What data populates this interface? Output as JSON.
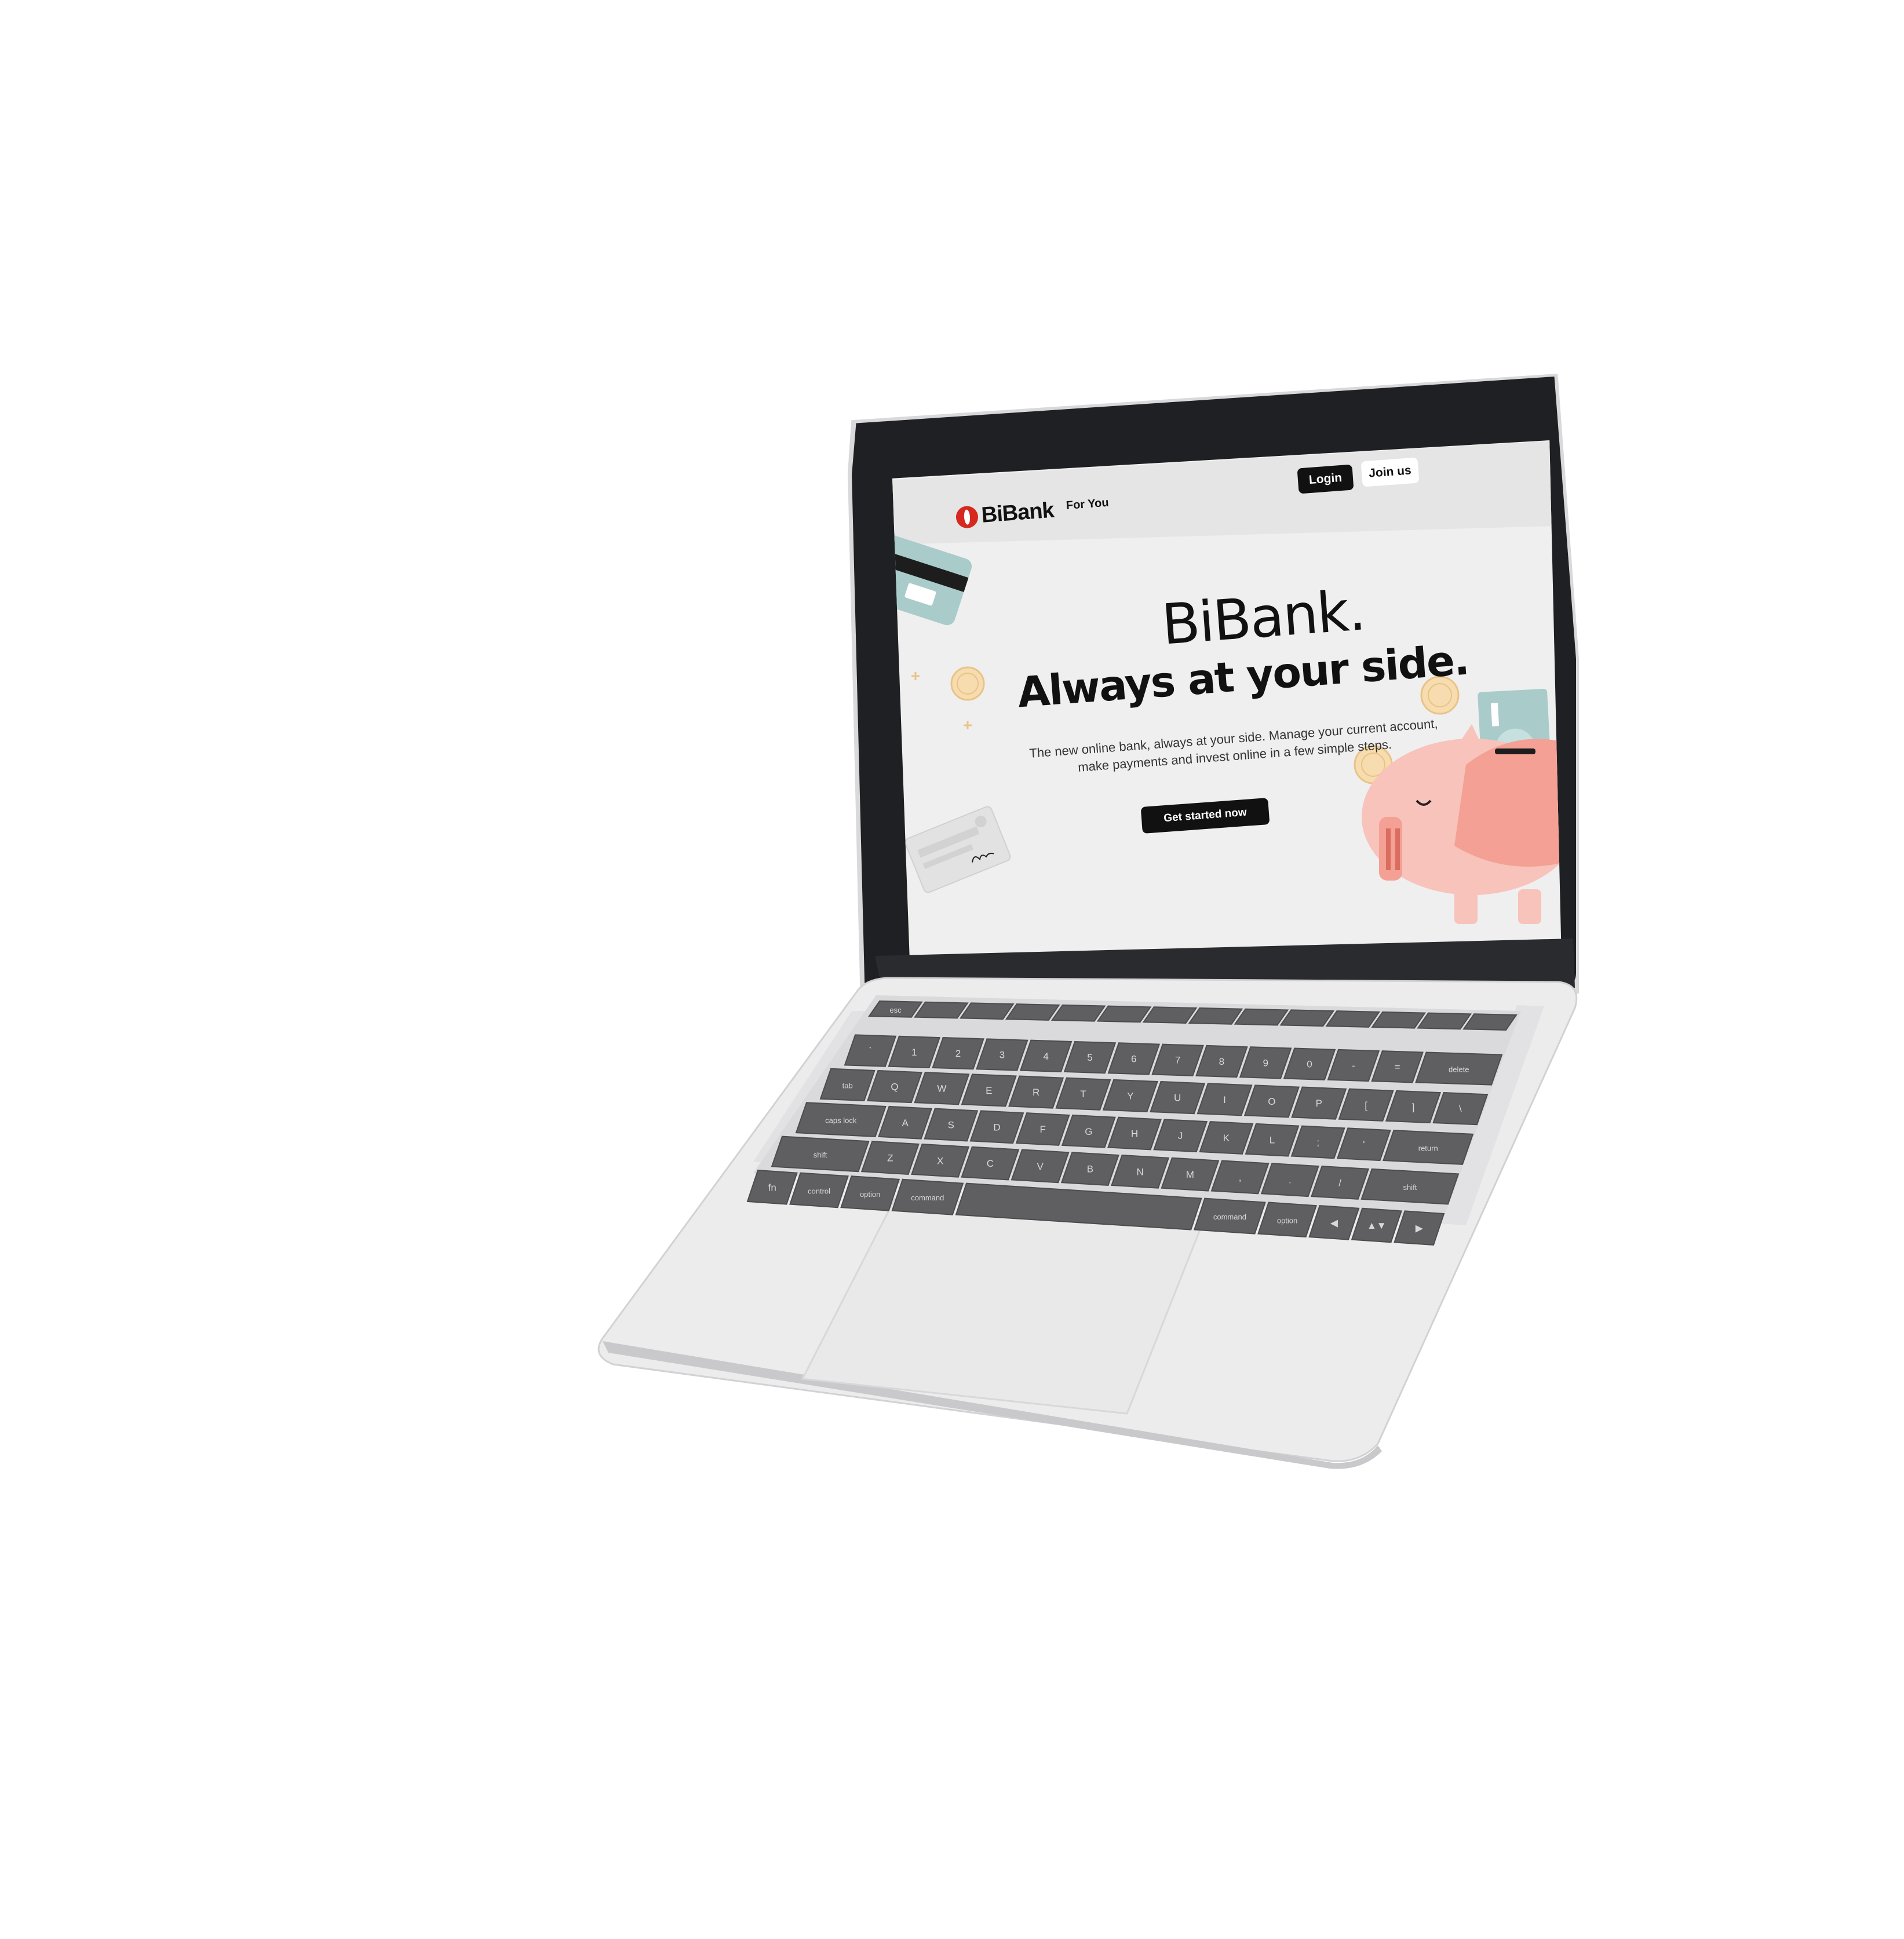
{
  "site": {
    "brand": "BiBank",
    "nav": {
      "for_you": "For You"
    },
    "auth": {
      "login": "Login",
      "join": "Join us"
    },
    "hero": {
      "title": "BiBank.",
      "tagline": "Always at your side.",
      "subtitle_line1": "The new online bank, always at your side. Manage your current account,",
      "subtitle_line2": "make payments and invest online in a few simple steps.",
      "cta": "Get started now"
    }
  },
  "colors": {
    "brand_red": "#d7281f",
    "button_dark": "#111111",
    "page_bg": "#efefef",
    "nav_bg": "#e5e5e5",
    "card_teal": "#a9cccb",
    "piggy_pink": "#f4a094",
    "coin_gold": "#f6dcae"
  },
  "keyboard": {
    "row0": [
      "esc",
      "",
      "",
      "",
      "",
      "",
      "",
      "",
      "",
      "",
      "",
      "",
      "",
      ""
    ],
    "row1": [
      "`",
      "1",
      "2",
      "3",
      "4",
      "5",
      "6",
      "7",
      "8",
      "9",
      "0",
      "-",
      "=",
      "delete"
    ],
    "row2": [
      "tab",
      "Q",
      "W",
      "E",
      "R",
      "T",
      "Y",
      "U",
      "I",
      "O",
      "P",
      "[",
      "]",
      "\\"
    ],
    "row3": [
      "caps lock",
      "A",
      "S",
      "D",
      "F",
      "G",
      "H",
      "J",
      "K",
      "L",
      ";",
      "'",
      "return"
    ],
    "row4": [
      "shift",
      "Z",
      "X",
      "C",
      "V",
      "B",
      "N",
      "M",
      ",",
      ".",
      "/",
      "shift"
    ],
    "row5": [
      "fn",
      "control",
      "option",
      "command",
      "",
      "command",
      "option",
      "◀",
      "▲▼",
      "▶"
    ]
  }
}
